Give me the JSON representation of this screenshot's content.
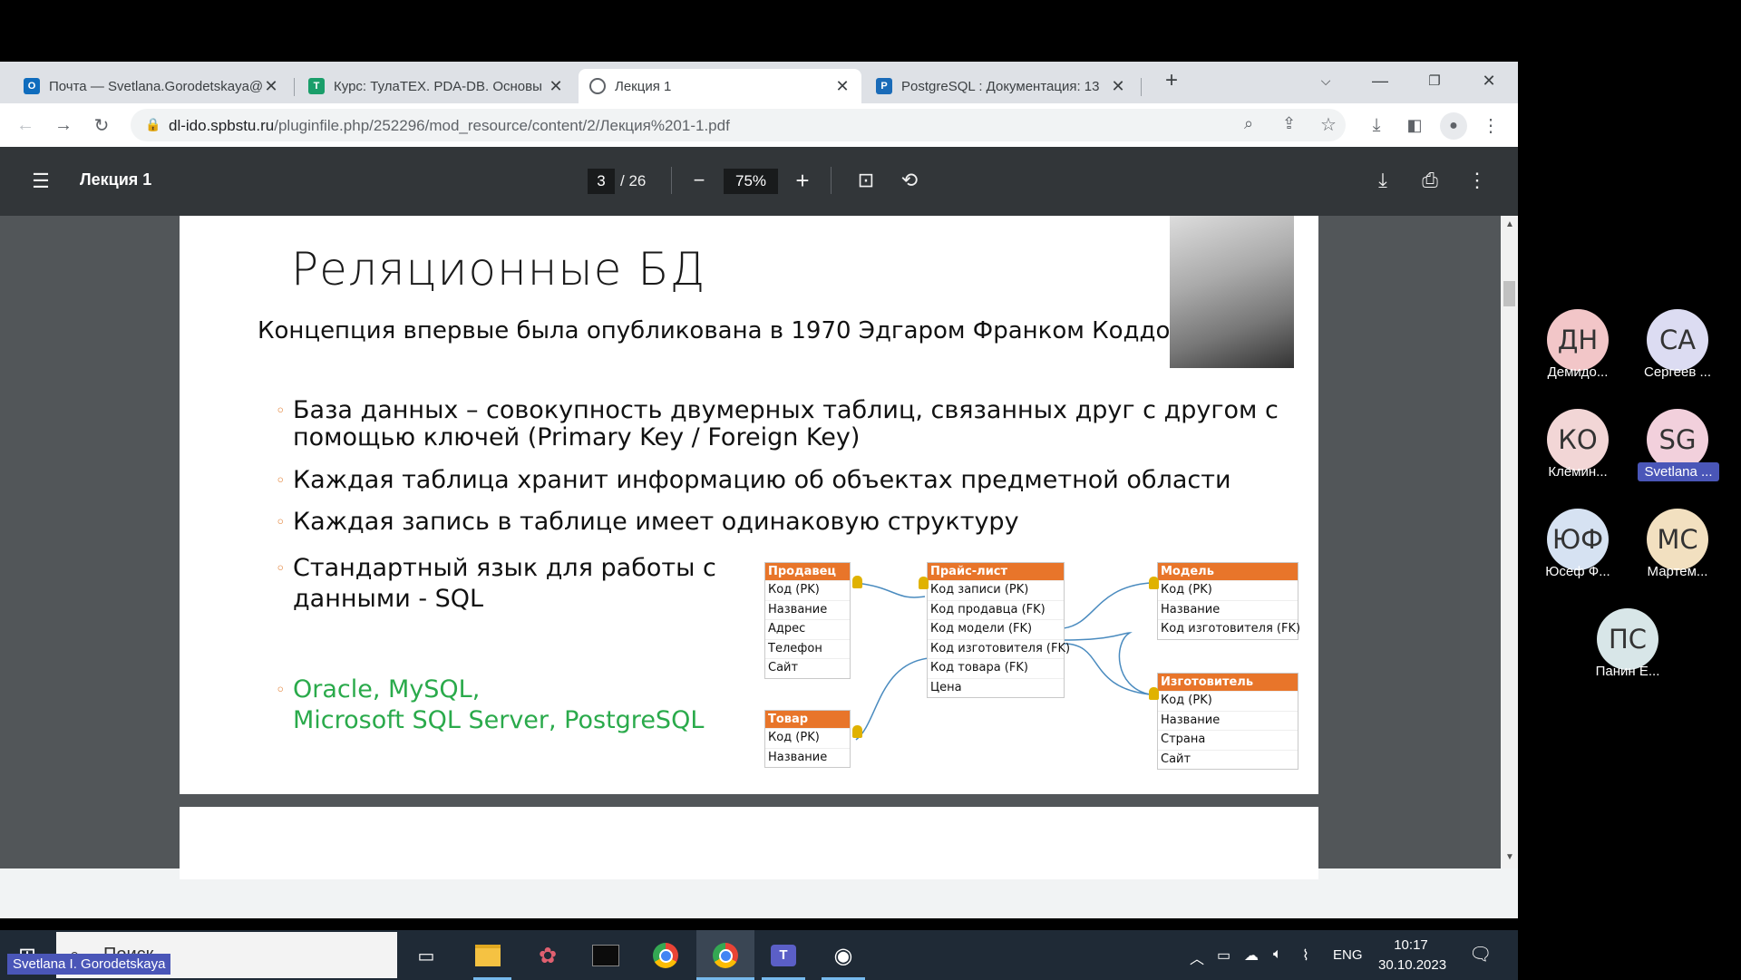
{
  "tabs": [
    {
      "title": "Почта — Svetlana.Gorodetskaya@",
      "icon": "outlook-icon",
      "color": "#0f6cbd"
    },
    {
      "title": "Курс: ТулаТЕХ. PDA-DB. Основы",
      "icon": "course-icon",
      "color": "#1a9e6a"
    },
    {
      "title": "Лекция 1",
      "icon": "globe-icon",
      "color": "#5f6368"
    },
    {
      "title": "PostgreSQL : Документация: 13",
      "icon": "postgres-icon",
      "color": "#1a6bb8"
    }
  ],
  "address": {
    "host": "dl-ido.spbstu.ru",
    "path": "/pluginfile.php/252296/mod_resource/content/2/Лекция%201-1.pdf"
  },
  "pdf": {
    "title": "Лекция 1",
    "page": "3",
    "total": "/ 26",
    "zoom": "75%"
  },
  "slide": {
    "title": "Реляционные БД",
    "subtitle": "Концепция впервые была опубликована в 1970 Эдгаром Франком Коддом",
    "bullets": [
      "База данных – совокупность  двумерных таблиц, связанных друг с другом с",
      "помощью ключей (Primary Key / Foreign Key)",
      "Каждая таблица хранит информацию об объектах предметной области",
      "Каждая запись в таблице имеет одинаковую структуру",
      "Стандартный язык для работы с",
      "данными - SQL",
      "Oracle, MySQL,",
      "Microsoft SQL Server, PostgreSQL"
    ],
    "er_tables": {
      "prodavec": {
        "title": "Продавец",
        "rows": [
          "Код (PK)",
          "Название",
          "Адрес",
          "Телефон",
          "Сайт"
        ]
      },
      "price": {
        "title": "Прайс-лист",
        "rows": [
          "Код записи (PK)",
          "Код продавца (FK)",
          "Код модели (FK)",
          "Код изготовителя (FK)",
          "Код товара (FK)",
          "Цена"
        ]
      },
      "model": {
        "title": "Модель",
        "rows": [
          "Код (PK)",
          "Название",
          "Код изготовителя (FK)"
        ]
      },
      "tovar": {
        "title": "Товар",
        "rows": [
          "Код (PK)",
          "Название"
        ]
      },
      "izgot": {
        "title": "Изготовитель",
        "rows": [
          "Код (PK)",
          "Название",
          "Страна",
          "Сайт"
        ]
      }
    }
  },
  "taskbar": {
    "search": "Поиск",
    "lang": "ENG",
    "time": "10:17",
    "date": "30.10.2023"
  },
  "participants": [
    {
      "initials": "ДН",
      "name": "Демидо...",
      "color": "#f2c6c8"
    },
    {
      "initials": "СА",
      "name": "Сергеев ...",
      "color": "#dcdcf2"
    },
    {
      "initials": "КО",
      "name": "Клёмин...",
      "color": "#f2d6d6"
    },
    {
      "initials": "SG",
      "name": "Svetlana ...",
      "color": "#f2d0dc"
    },
    {
      "initials": "ЮФ",
      "name": "Юсеф Ф...",
      "color": "#d6e2f2"
    },
    {
      "initials": "МС",
      "name": "Мартем...",
      "color": "#f2e0c0"
    },
    {
      "initials": "ПС",
      "name": "Панин Е...",
      "color": "#d8e6e8"
    }
  ],
  "presenter": "Svetlana I. Gorodetskaya"
}
